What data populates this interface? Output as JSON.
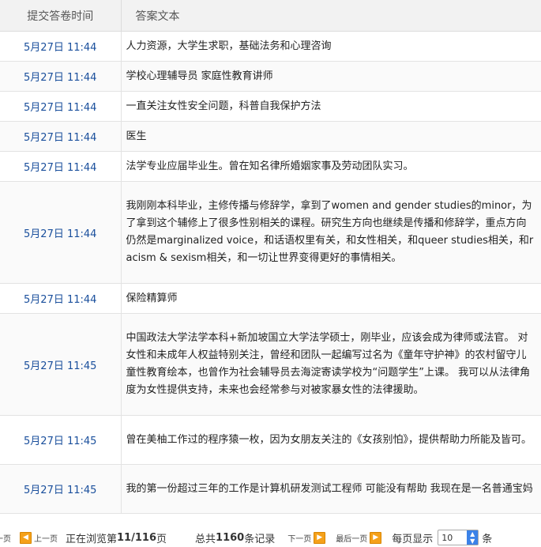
{
  "table": {
    "header_time": "提交答卷时间",
    "header_text": "答案文本",
    "rows": [
      {
        "time": "5月27日 11:44",
        "text": "人力资源，大学生求职，基础法务和心理咨询"
      },
      {
        "time": "5月27日 11:44",
        "text": "学校心理辅导员 家庭性教育讲师"
      },
      {
        "time": "5月27日 11:44",
        "text": "一直关注女性安全问题，科普自我保护方法"
      },
      {
        "time": "5月27日 11:44",
        "text": "医生"
      },
      {
        "time": "5月27日 11:44",
        "text": "法学专业应届毕业生。曾在知名律所婚姻家事及劳动团队实习。"
      },
      {
        "time": "5月27日 11:44",
        "text": "我刚刚本科毕业，主修传播与修辞学，拿到了women and gender studies的minor，为了拿到这个辅修上了很多性别相关的课程。研究生方向也继续是传播和修辞学，重点方向仍然是marginalized voice，和话语权里有关，和女性相关，和queer studies相关，和racism & sexism相关，和一切让世界变得更好的事情相关。"
      },
      {
        "time": "5月27日 11:44",
        "text": "保险精算师"
      },
      {
        "time": "5月27日 11:45",
        "text": "中国政法大学法学本科+新加坡国立大学法学硕士，刚毕业，应该会成为律师或法官。 对女性和未成年人权益特别关注，曾经和团队一起编写过名为《童年守护神》的农村留守儿童性教育绘本，也曾作为社会辅导员去海淀寄读学校为“问题学生”上课。 我可以从法律角度为女性提供支持，未来也会经常参与对被家暴女性的法律援助。"
      },
      {
        "time": "5月27日 11:45",
        "text": "曾在美柚工作过的程序猿一枚，因为女朋友关注的《女孩别怕》，提供帮助力所能及皆可。"
      },
      {
        "time": "5月27日 11:45",
        "text": "我的第一份超过三年的工作是计算机研发测试工程师 可能没有帮助 我现在是一名普通宝妈"
      }
    ]
  },
  "pager": {
    "first_label": "一页",
    "prev_label": "上一页",
    "browse_prefix": "正在浏览第",
    "browse_value": "11/116",
    "browse_suffix": "页",
    "total_prefix": "总共",
    "total_value": "1160",
    "total_suffix": "条记录",
    "next_label": "下一页",
    "last_label": "最后一页",
    "page_size_label": "每页显示",
    "page_size_value": "10",
    "page_size_suffix": "条",
    "accent_color": "#f5a11a"
  }
}
